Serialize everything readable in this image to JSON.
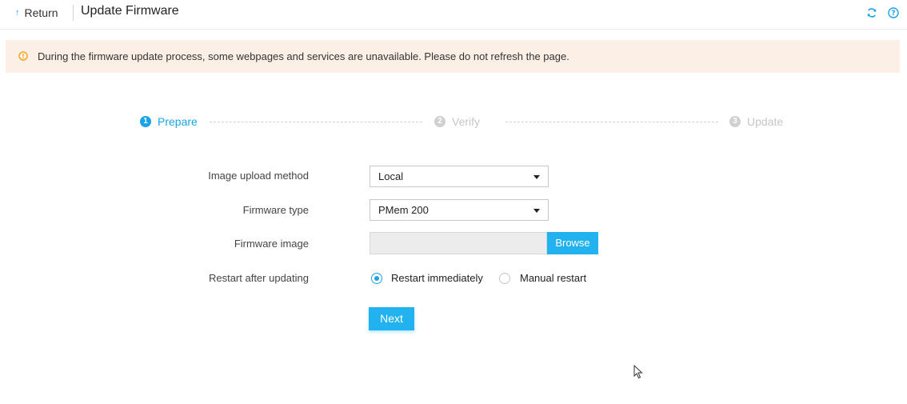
{
  "header": {
    "return_label": "Return",
    "title": "Update Firmware",
    "icons": [
      "refresh-icon",
      "help-icon"
    ]
  },
  "notice": {
    "text": "During the firmware update process, some webpages and services are unavailable. Please do not refresh the page.",
    "icon": "warning-icon"
  },
  "steps": [
    {
      "number": "1",
      "label": "Prepare",
      "state": "active"
    },
    {
      "number": "2",
      "label": "Verify",
      "state": "inactive"
    },
    {
      "number": "3",
      "label": "Update",
      "state": "inactive"
    }
  ],
  "form": {
    "upload_method": {
      "label": "Image upload method",
      "value": "Local"
    },
    "firmware_type": {
      "label": "Firmware type",
      "value": "PMem 200"
    },
    "firmware_image": {
      "label": "Firmware image",
      "value": "",
      "browse_label": "Browse"
    },
    "restart": {
      "label": "Restart after updating",
      "options": [
        {
          "label": "Restart immediately",
          "selected": true
        },
        {
          "label": "Manual restart",
          "selected": false
        }
      ]
    },
    "next_label": "Next"
  },
  "colors": {
    "accent": "#1aa3e8",
    "button": "#22b2ef",
    "notice_bg": "#fcefe6",
    "notice_icon": "#f5a623",
    "inactive": "#c6c6c6"
  }
}
